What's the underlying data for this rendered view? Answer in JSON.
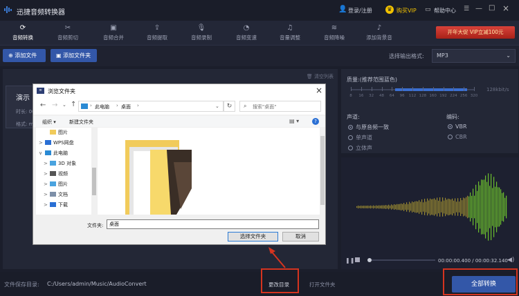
{
  "app": {
    "title": "迅捷音频转换器",
    "login": "登录/注册",
    "buy_vip": "购买VIP",
    "help": "帮助中心"
  },
  "toolbar": {
    "tabs": [
      {
        "label": "音频转换",
        "icon": "⟳"
      },
      {
        "label": "音频剪切",
        "icon": "✂"
      },
      {
        "label": "音频合并",
        "icon": "▣"
      },
      {
        "label": "音频提取",
        "icon": "⇪"
      },
      {
        "label": "音频录制",
        "icon": "🎙"
      },
      {
        "label": "音频变速",
        "icon": "◔"
      },
      {
        "label": "音量调整",
        "icon": "♫"
      },
      {
        "label": "音频降噪",
        "icon": "≋"
      },
      {
        "label": "添加背景音",
        "icon": "♪"
      }
    ],
    "promo": "开年大促 VIP立减100元"
  },
  "subbar": {
    "add_file": "添加文件",
    "add_folder": "添加文件夹",
    "format_label": "选择输出格式:",
    "format_value": "MP3"
  },
  "list": {
    "clear": "清空列表",
    "item_title": "演示",
    "item_line1": "时长: 00",
    "item_line2": "格式: mp"
  },
  "settings": {
    "quality_label": "质量:(推荐范围蓝色)",
    "quality_ticks": [
      "8",
      "16",
      "32",
      "48",
      "64",
      "96",
      "112",
      "128",
      "160",
      "192",
      "224",
      "256",
      "320"
    ],
    "quality_value": "128kbit/s",
    "channel_label": "声道:",
    "channels": [
      "与原音频一致",
      "单声道",
      "立体声"
    ],
    "encoding_label": "编码:",
    "encodings": [
      "VBR",
      "CBR"
    ]
  },
  "player": {
    "time": "00:00:00.400 / 00:00:32.140"
  },
  "bottom": {
    "save_label": "文件保存目录:",
    "save_path": "C:/Users/admin/Music/AudioConvert",
    "change_dir": "更改目录",
    "open_folder": "打开文件夹",
    "convert_all": "全部转换"
  },
  "dialog": {
    "title": "浏览文件夹",
    "crumbs": [
      "此电脑",
      "桌面"
    ],
    "search_placeholder": "搜索\"桌面\"",
    "organize": "组织 ▾",
    "new_folder": "新建文件夹",
    "tree": [
      {
        "label": "图片",
        "indent": 1,
        "arrow": "",
        "icon": "folder"
      },
      {
        "label": "WPS网盘",
        "indent": 0,
        "arrow": ">",
        "icon": "cloud"
      },
      {
        "label": "此电脑",
        "indent": 0,
        "arrow": "∨",
        "icon": "pc"
      },
      {
        "label": "3D 对象",
        "indent": 1,
        "arrow": ">",
        "icon": "obj3d"
      },
      {
        "label": "视频",
        "indent": 1,
        "arrow": ">",
        "icon": "video"
      },
      {
        "label": "图片",
        "indent": 1,
        "arrow": ">",
        "icon": "pic"
      },
      {
        "label": "文档",
        "indent": 1,
        "arrow": ">",
        "icon": "doc"
      },
      {
        "label": "下载",
        "indent": 1,
        "arrow": ">",
        "icon": "down"
      }
    ],
    "folder_label": "文件夹:",
    "folder_value": "桌面",
    "select_btn": "选择文件夹",
    "cancel_btn": "取消"
  },
  "colors": {
    "accent": "#3357a8",
    "vip": "#f2c200",
    "promo": "#c0392b",
    "wave": "#7ec33a",
    "annotation": "#d6341f"
  }
}
